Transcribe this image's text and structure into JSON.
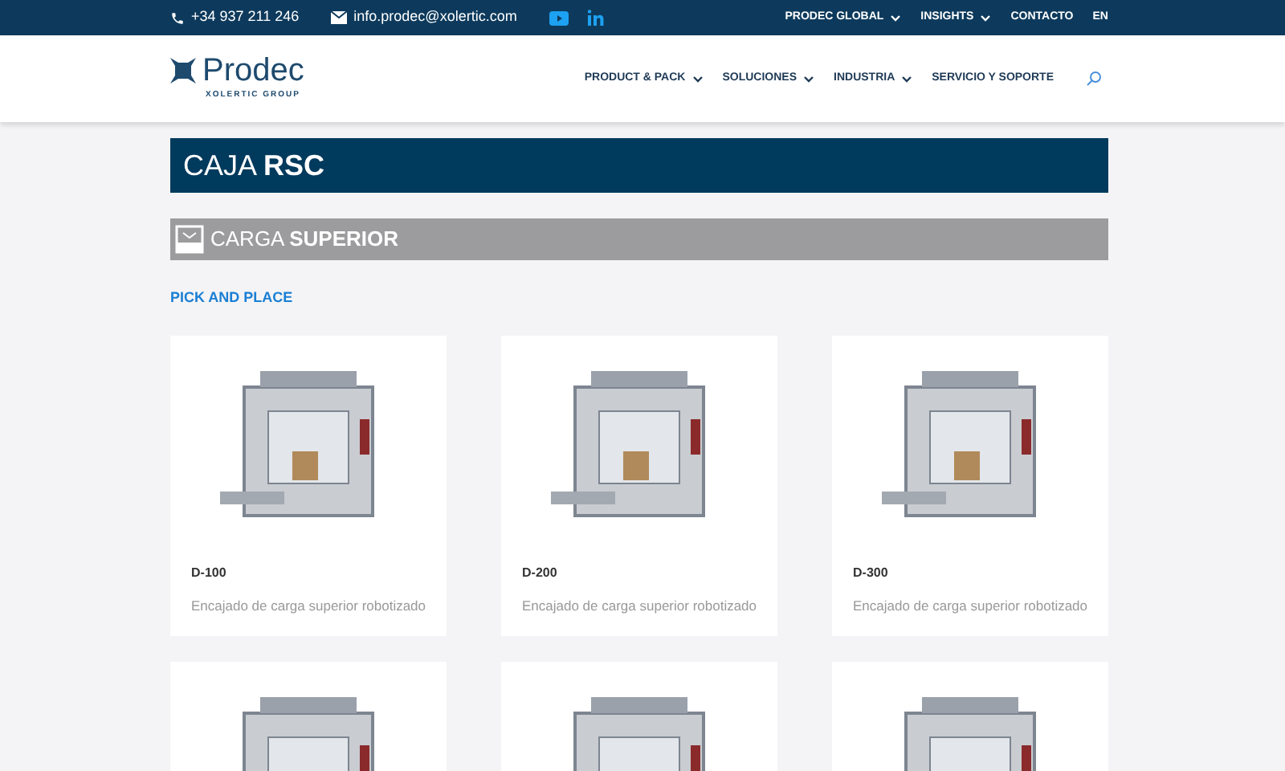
{
  "top_bar": {
    "phone": "+34 937 211 246",
    "email": "info.prodec@xolertic.com",
    "menu": [
      {
        "label": "PRODEC GLOBAL",
        "dropdown": true
      },
      {
        "label": "INSIGHTS",
        "dropdown": true
      },
      {
        "label": "CONTACTO",
        "dropdown": false
      },
      {
        "label": "EN",
        "dropdown": false
      }
    ]
  },
  "header": {
    "logo": "Prodec",
    "logo_sub": "XOLERTIC GROUP",
    "nav": [
      {
        "label": "PRODUCT & PACK",
        "dropdown": true
      },
      {
        "label": "SOLUCIONES",
        "dropdown": true
      },
      {
        "label": "INDUSTRIA",
        "dropdown": true
      },
      {
        "label": "SERVICIO Y SOPORTE",
        "dropdown": false
      }
    ]
  },
  "page_title": "CAJA **RSC**",
  "section_title": "CARGA **SUPERIOR**",
  "subsection": "PICK AND PLACE",
  "cards": [
    {
      "kind": "full",
      "code": "D-100",
      "description": "Encajado de carga superior robotizado"
    },
    {
      "kind": "full",
      "code": "D-200",
      "description": "Encajado de carga superior robotizado"
    },
    {
      "kind": "full",
      "code": "D-300",
      "description": "Encajado de carga superior robotizado"
    },
    {
      "kind": "image_only"
    },
    {
      "kind": "image_only"
    },
    {
      "kind": "image_only"
    }
  ]
}
